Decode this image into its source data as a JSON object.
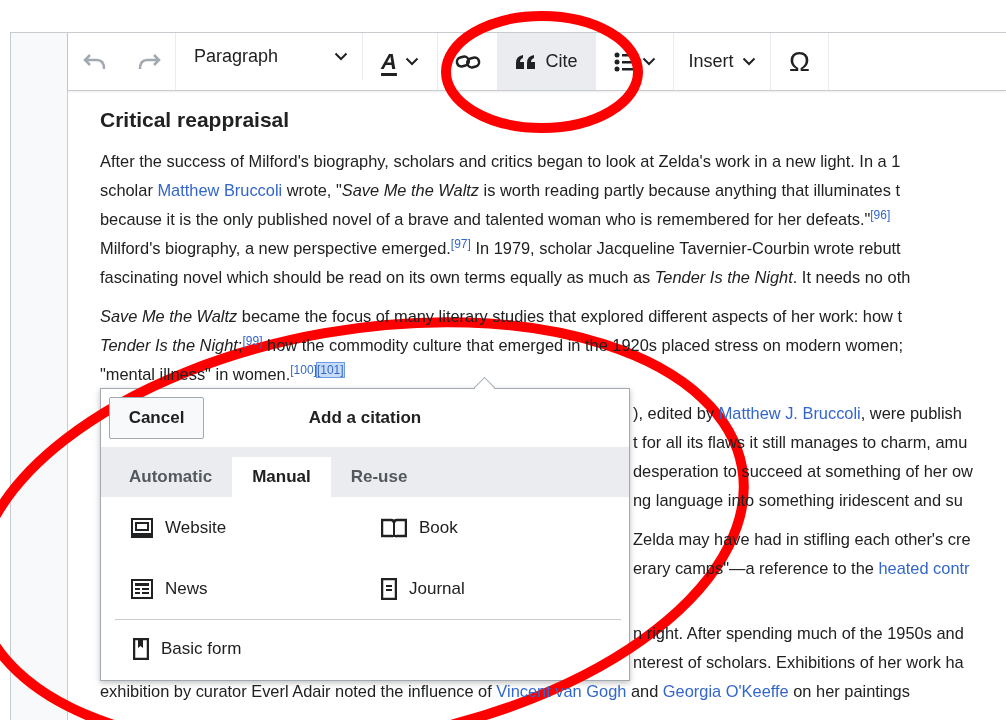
{
  "toolbar": [
    {
      "kind": "undo",
      "disabled": true
    },
    {
      "kind": "redo",
      "disabled": true
    },
    {
      "kind": "dropdown",
      "label": "Paragraph"
    },
    {
      "kind": "style",
      "label": "A"
    },
    {
      "kind": "link"
    },
    {
      "kind": "cite",
      "label": "Cite",
      "selected": true
    },
    {
      "kind": "list"
    },
    {
      "kind": "dropdown",
      "label": "Insert"
    },
    {
      "kind": "char",
      "label": "Ω"
    }
  ],
  "article": {
    "heading": "Critical reappraisal",
    "paragraphs": [
      {
        "lines": [
          {
            "kind": "full",
            "segments": [
              {
                "kind": "text",
                "text": "After the success of Milford's biography, scholars and critics began to look at Zelda's work in a new light. In a 1"
              }
            ]
          },
          {
            "kind": "full",
            "segments": [
              {
                "kind": "text",
                "text": "scholar "
              },
              {
                "kind": "link",
                "text": "Matthew Bruccoli"
              },
              {
                "kind": "text",
                "text": " wrote, \"*Save Me the Waltz* is worth reading partly because anything that illuminates t"
              }
            ]
          },
          {
            "kind": "full",
            "segments": [
              {
                "kind": "text",
                "text": "because it is the only published novel of a brave and talented woman who is remembered for her defeats.\""
              },
              {
                "kind": "ref",
                "text": "[96]",
                "selected": false
              }
            ]
          },
          {
            "kind": "full",
            "segments": [
              {
                "kind": "text",
                "text": "Milford's biography, a new perspective emerged."
              },
              {
                "kind": "ref",
                "text": "[97]",
                "selected": false
              },
              {
                "kind": "text",
                "text": " In 1979, scholar Jacqueline Tavernier-Courbin wrote rebutt"
              }
            ]
          },
          {
            "kind": "full",
            "segments": [
              {
                "kind": "text",
                "text": "fascinating novel which should be read on its own terms equally as much as *Tender Is the Night*. It needs no oth"
              }
            ]
          }
        ]
      },
      {
        "lines": [
          {
            "kind": "full",
            "segments": [
              {
                "kind": "text",
                "text": "*Save Me the Waltz* became the focus of many literary studies that explored different aspects of her work: how t"
              }
            ]
          },
          {
            "kind": "full",
            "segments": [
              {
                "kind": "text",
                "text": "*Tender Is the Night*;"
              },
              {
                "kind": "ref",
                "text": "[99]",
                "selected": false
              },
              {
                "kind": "text",
                "text": " how the commodity culture that emerged in the 1920s placed stress on modern women;"
              }
            ]
          },
          {
            "kind": "full",
            "segments": [
              {
                "kind": "text",
                "text": "\"mental illness\" in women."
              },
              {
                "kind": "ref",
                "text": "[100]",
                "selected": false
              },
              {
                "kind": "ref",
                "text": "[101]",
                "selected": true
              }
            ]
          }
        ]
      },
      {
        "lines": [
          {
            "kind": "tail",
            "segments": [
              {
                "kind": "text",
                "text": "), edited by "
              },
              {
                "kind": "link",
                "text": "Matthew J. Bruccoli"
              },
              {
                "kind": "text",
                "text": ", were publish"
              }
            ]
          },
          {
            "kind": "tail",
            "segments": [
              {
                "kind": "text",
                "text": "t for all its flaws it still manages to charm, amu"
              }
            ]
          },
          {
            "kind": "tail",
            "segments": [
              {
                "kind": "text",
                "text": "desperation to succeed at something of her ow"
              }
            ]
          },
          {
            "kind": "tail",
            "segments": [
              {
                "kind": "text",
                "text": "ng language into something iridescent and su"
              }
            ]
          }
        ]
      },
      {
        "lines": [
          {
            "kind": "tail",
            "segments": [
              {
                "kind": "text",
                "text": "Zelda may have had in stifling each other's cre"
              }
            ]
          },
          {
            "kind": "tail",
            "segments": [
              {
                "kind": "text",
                "text": "erary camps\"—a reference to the "
              },
              {
                "kind": "link",
                "text": "heated contr"
              }
            ]
          }
        ]
      },
      {
        "lines": [
          {
            "kind": "tail",
            "segments": [
              {
                "kind": "text",
                "text": "n right. After spending much of the 1950s and"
              }
            ]
          },
          {
            "kind": "tail",
            "segments": [
              {
                "kind": "text",
                "text": "nterest of scholars.  Exhibitions of her work ha"
              }
            ]
          },
          {
            "kind": "full",
            "segments": [
              {
                "kind": "text",
                "text": "exhibition by curator Everl Adair noted the influence of "
              },
              {
                "kind": "link",
                "text": "Vincent van Gogh"
              },
              {
                "kind": "text",
                "text": " and "
              },
              {
                "kind": "link",
                "text": "Georgia O'Keeffe"
              },
              {
                "kind": "text",
                "text": " on her paintings"
              }
            ]
          }
        ]
      }
    ]
  },
  "citation_dialog": {
    "title": "Add a citation",
    "cancel": "Cancel",
    "tabs": [
      {
        "label": "Automatic",
        "selected": false
      },
      {
        "label": "Manual",
        "selected": true
      },
      {
        "label": "Re-use",
        "selected": false
      }
    ],
    "options": [
      {
        "kind": "website",
        "label": "Website"
      },
      {
        "kind": "book",
        "label": "Book"
      },
      {
        "kind": "news",
        "label": "News"
      },
      {
        "kind": "journal",
        "label": "Journal"
      }
    ],
    "basic": {
      "kind": "basic",
      "label": "Basic form"
    }
  }
}
